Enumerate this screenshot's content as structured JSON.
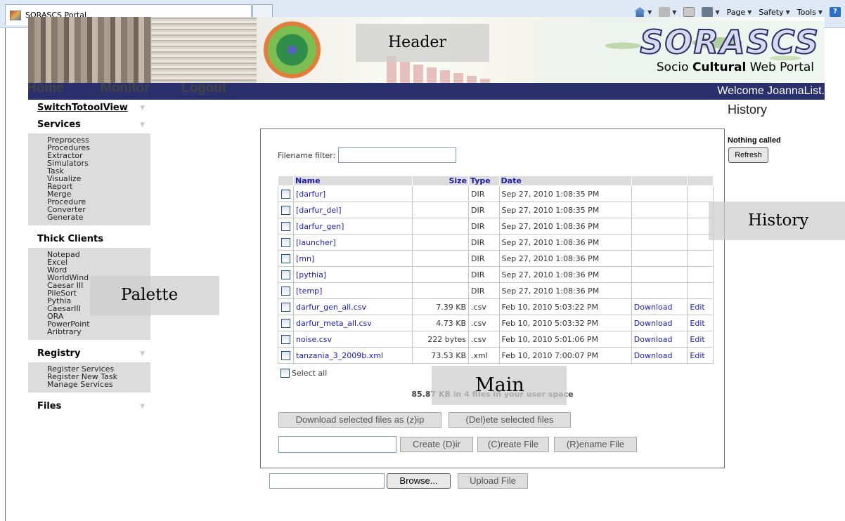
{
  "browser": {
    "tab_title": "SORASCS Portal",
    "commands": [
      "Page",
      "Safety",
      "Tools"
    ]
  },
  "banner": {
    "logo_text": "SORASCS",
    "tagline_pre": "Socio ",
    "tagline_bold": "Cultural",
    "tagline_post": " Web Portal"
  },
  "nav": {
    "items": [
      "Home",
      "Monitor",
      "Logout"
    ],
    "welcome": "Welcome JoannaList."
  },
  "sidebar": {
    "switch_label": "SwitchTotoolView",
    "sections": [
      {
        "title": "Services",
        "items": [
          "Preprocess",
          "Procedures",
          "Extractor",
          "Simulators",
          "Task",
          "Visualize",
          "Report",
          "Merge",
          "Procedure",
          "Converter",
          "Generate"
        ]
      },
      {
        "title": "Thick Clients",
        "items": [
          "Notepad",
          "Excel",
          "Word",
          "WorldWind",
          "Caesar III",
          "PileSort",
          "Pythia",
          "CaesarIII",
          "ORA",
          "PowerPoint",
          "Aribtrary"
        ]
      },
      {
        "title": "Registry",
        "items": [
          "Register Services",
          "Register New Task",
          "Manage Services"
        ]
      },
      {
        "title": "Files",
        "items": []
      }
    ]
  },
  "main": {
    "filter_label": "Filename filter:",
    "filter_value": "",
    "columns": {
      "name": "Name",
      "size": "Size",
      "type": "Type",
      "date": "Date"
    },
    "files": [
      {
        "name": "[darfur]",
        "size": "",
        "type": "DIR",
        "date": "Sep 27, 2010 1:08:35 PM",
        "download": "",
        "edit": ""
      },
      {
        "name": "[darfur_del]",
        "size": "",
        "type": "DIR",
        "date": "Sep 27, 2010 1:08:35 PM",
        "download": "",
        "edit": ""
      },
      {
        "name": "[darfur_gen]",
        "size": "",
        "type": "DIR",
        "date": "Sep 27, 2010 1:08:36 PM",
        "download": "",
        "edit": ""
      },
      {
        "name": "[launcher]",
        "size": "",
        "type": "DIR",
        "date": "Sep 27, 2010 1:08:36 PM",
        "download": "",
        "edit": ""
      },
      {
        "name": "[mn]",
        "size": "",
        "type": "DIR",
        "date": "Sep 27, 2010 1:08:36 PM",
        "download": "",
        "edit": ""
      },
      {
        "name": "[pythia]",
        "size": "",
        "type": "DIR",
        "date": "Sep 27, 2010 1:08:36 PM",
        "download": "",
        "edit": ""
      },
      {
        "name": "[temp]",
        "size": "",
        "type": "DIR",
        "date": "Sep 27, 2010 1:08:36 PM",
        "download": "",
        "edit": ""
      },
      {
        "name": "darfur_gen_all.csv",
        "size": "7.39 KB",
        "type": ".csv",
        "date": "Feb 10, 2010 5:03:22 PM",
        "download": "Download",
        "edit": "Edit"
      },
      {
        "name": "darfur_meta_all.csv",
        "size": "4.73 KB",
        "type": ".csv",
        "date": "Feb 10, 2010 5:03:32 PM",
        "download": "Download",
        "edit": "Edit"
      },
      {
        "name": "noise.csv",
        "size": "222 bytes",
        "type": ".csv",
        "date": "Feb 10, 2010 5:01:06 PM",
        "download": "Download",
        "edit": "Edit"
      },
      {
        "name": "tanzania_3_2009b.xml",
        "size": "73.53 KB",
        "type": ".xml",
        "date": "Feb 10, 2010 7:00:07 PM",
        "download": "Download",
        "edit": "Edit"
      }
    ],
    "select_all": "Select all",
    "summary": "85.87 KB in 4 files in your user space",
    "buttons": {
      "download_zip": "Download selected files as (z)ip",
      "delete": "(Del)ete selected files",
      "create_dir": "Create (D)ir",
      "create_file": "(C)reate File",
      "rename": "(R)ename File",
      "browse": "Browse...",
      "upload": "Upload File"
    }
  },
  "history": {
    "title": "History",
    "status": "Nothing called",
    "refresh": "Refresh"
  },
  "region_labels": {
    "header": "Header",
    "palette": "Palette",
    "main": "Main",
    "history": "History"
  }
}
